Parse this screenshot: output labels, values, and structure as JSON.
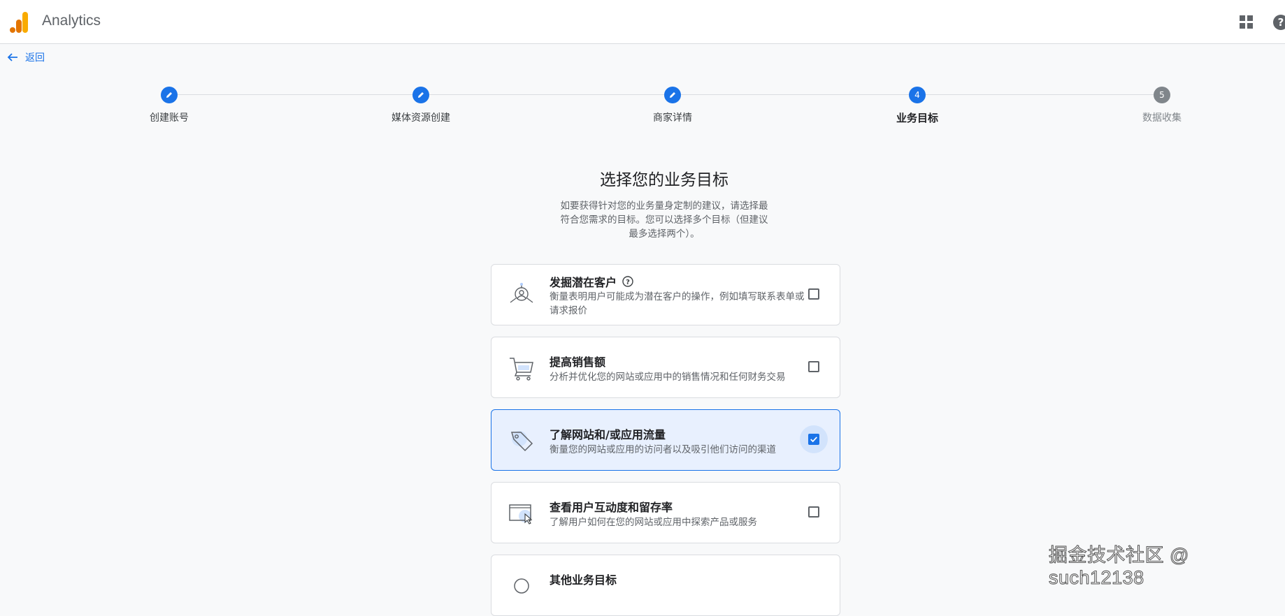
{
  "header": {
    "app_title": "Analytics",
    "logo_icon": "analytics-logo-icon",
    "apps_icon": "apps-grid-icon",
    "help_icon": "help-icon",
    "brand_color": "#f9ab00",
    "brand_color_dark": "#e37400"
  },
  "back": {
    "label": "返回",
    "icon": "arrow-left-icon"
  },
  "stepper": {
    "steps": [
      {
        "label": "创建账号",
        "state": "done"
      },
      {
        "label": "媒体资源创建",
        "state": "done"
      },
      {
        "label": "商家详情",
        "state": "done"
      },
      {
        "label": "业务目标",
        "state": "active",
        "number": "4"
      },
      {
        "label": "数据收集",
        "state": "pending",
        "number": "5"
      }
    ]
  },
  "main": {
    "title": "选择您的业务目标",
    "description": "如要获得针对您的业务量身定制的建议，请选择最符合您需求的目标。您可以选择多个目标（但建议最多选择两个）。",
    "goals": [
      {
        "title": "发掘潜在客户",
        "description": "衡量表明用户可能成为潜在客户的操作，例如填写联系表单或请求报价",
        "checked": false,
        "has_help": true,
        "icon": "lead-generation-icon"
      },
      {
        "title": "提高销售额",
        "description": "分析并优化您的网站或应用中的销售情况和任何财务交易",
        "checked": false,
        "has_help": false,
        "icon": "shopping-cart-icon"
      },
      {
        "title": "了解网站和/或应用流量",
        "description": "衡量您的网站或应用的访问者以及吸引他们访问的渠道",
        "checked": true,
        "has_help": false,
        "icon": "tag-icon"
      },
      {
        "title": "查看用户互动度和留存率",
        "description": "了解用户如何在您的网站或应用中探索产品或服务",
        "checked": false,
        "has_help": false,
        "icon": "screen-cursor-icon"
      },
      {
        "title": "其他业务目标",
        "description": "",
        "checked": false,
        "has_help": false,
        "icon": "other-goal-icon"
      }
    ]
  },
  "watermark": "掘金技术社区 @ such12138",
  "accent_color": "#1a73e8"
}
